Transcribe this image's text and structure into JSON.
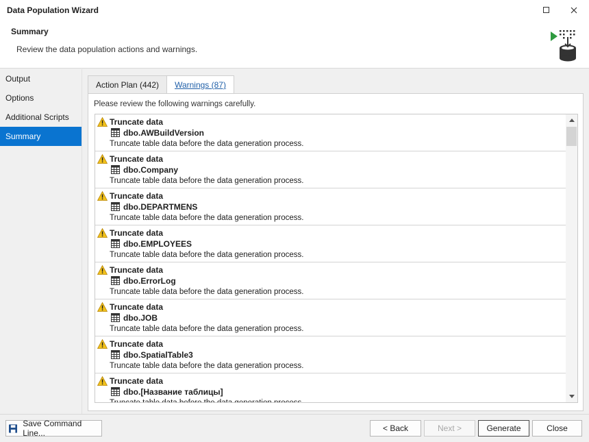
{
  "window": {
    "title": "Data Population Wizard"
  },
  "header": {
    "title": "Summary",
    "description": "Review the data population actions and warnings."
  },
  "sidebar": {
    "items": [
      {
        "label": "Output"
      },
      {
        "label": "Options"
      },
      {
        "label": "Additional Scripts"
      },
      {
        "label": "Summary",
        "active": true
      }
    ]
  },
  "tabs": [
    {
      "label": "Action Plan (442)"
    },
    {
      "label": "Warnings (87)",
      "active": true
    }
  ],
  "panel": {
    "intro": "Please review the following warnings carefully."
  },
  "warnings": [
    {
      "title": "Truncate data",
      "table": "dbo.AWBuildVersion",
      "description": "Truncate table data before the data generation process."
    },
    {
      "title": "Truncate data",
      "table": "dbo.Company",
      "description": "Truncate table data before the data generation process."
    },
    {
      "title": "Truncate data",
      "table": "dbo.DEPARTMENS",
      "description": "Truncate table data before the data generation process."
    },
    {
      "title": "Truncate data",
      "table": "dbo.EMPLOYEES",
      "description": "Truncate table data before the data generation process."
    },
    {
      "title": "Truncate data",
      "table": "dbo.ErrorLog",
      "description": "Truncate table data before the data generation process."
    },
    {
      "title": "Truncate data",
      "table": "dbo.JOB",
      "description": "Truncate table data before the data generation process."
    },
    {
      "title": "Truncate data",
      "table": "dbo.SpatialTable3",
      "description": "Truncate table data before the data generation process."
    },
    {
      "title": "Truncate data",
      "table": "dbo.[Название таблицы]",
      "description": "Truncate table data before the data generation process."
    }
  ],
  "footer": {
    "save_command_line": "Save Command Line...",
    "back": "< Back",
    "next": "Next >",
    "generate": "Generate",
    "close": "Close"
  },
  "colors": {
    "accent": "#0a74d0",
    "warning": "#f2c21b",
    "tab_active_text": "#1f5fa8"
  },
  "icons": {
    "warning": "warning-icon",
    "table": "table-icon",
    "save": "floppy-disk-icon",
    "logo": "database-populate-icon"
  }
}
